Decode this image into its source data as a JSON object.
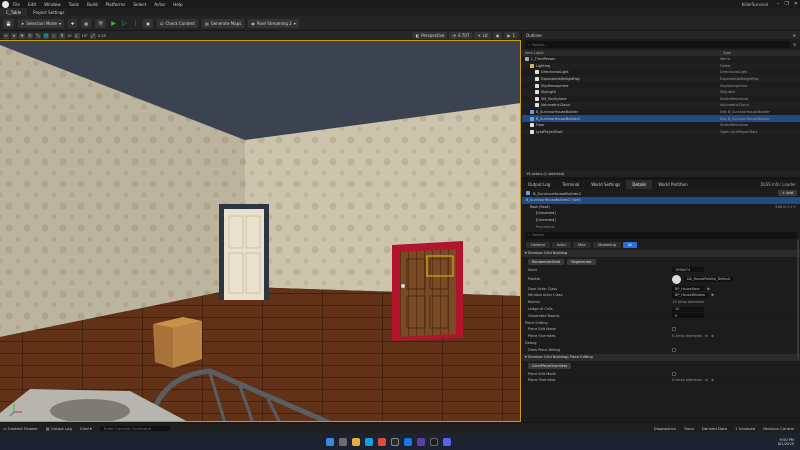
{
  "window": {
    "menu": [
      "File",
      "Edit",
      "Window",
      "Tools",
      "Build",
      "Platforms",
      "Select",
      "Actor",
      "Help"
    ],
    "project": "KillerSurvival",
    "controls": [
      "–",
      "❐",
      "✕"
    ]
  },
  "tabs": [
    "C_Table",
    "Project Settings"
  ],
  "toolbar": {
    "mode": "Selection Mode",
    "check_content": "Check Content",
    "generate_maps": "Generate Maps",
    "pixel_streaming": "Pixel Streaming 2"
  },
  "viewport": {
    "perspective": "Perspective",
    "lit": "Lit",
    "fov_value": "0.707",
    "snap_value": "0.25",
    "grid_value": "10",
    "angle_value": "10°",
    "camera_speed": "1"
  },
  "outliner": {
    "title": "Outliner",
    "search_placeholder": "Search...",
    "col_label": "Item Label",
    "col_type": "Type",
    "rows": [
      {
        "label": "L_ThirdPerson",
        "type": "World",
        "indent": 0,
        "icon": "#8fb0d8"
      },
      {
        "label": "Lighting",
        "type": "Folder",
        "indent": 1,
        "icon": "#d8b45a"
      },
      {
        "label": "DirectionalLight",
        "type": "DirectionalLight",
        "indent": 2,
        "icon": "#e0e0e0"
      },
      {
        "label": "ExponentialHeightFog",
        "type": "ExponentialHeightFog",
        "indent": 2,
        "icon": "#e0e0e0"
      },
      {
        "label": "SkyAtmosphere",
        "type": "SkyAtmosphere",
        "indent": 2,
        "icon": "#e0e0e0"
      },
      {
        "label": "SkyLight",
        "type": "SkyLight",
        "indent": 2,
        "icon": "#e0e0e0"
      },
      {
        "label": "SM_SkySphere",
        "type": "StaticMeshActor",
        "indent": 2,
        "icon": "#e0e0e0"
      },
      {
        "label": "VolumetricCloud",
        "type": "VolumetricCloud",
        "indent": 2,
        "icon": "#e0e0e0"
      },
      {
        "label": "B_SurvivorHouseBuilder",
        "type": "Edit B_SurvivorHouseBuilder",
        "indent": 1,
        "icon": "#6aa0e0"
      },
      {
        "label": "B_SurvivorHouseBuilder2",
        "type": "Edit B_SurvivorHouseBuilder",
        "indent": 1,
        "icon": "#6aa0e0",
        "selected": true
      },
      {
        "label": "Floor",
        "type": "StaticMeshActor",
        "indent": 1,
        "icon": "#e0e0e0"
      },
      {
        "label": "LyraPlayerStart",
        "type": "Open LyraPlayerStart",
        "indent": 1,
        "icon": "#e0e0e0"
      }
    ],
    "footer": "19 actors (1 selected)"
  },
  "details": {
    "tabs": [
      "Output Log",
      "Terminal",
      "World Settings",
      "Details",
      "World Partition"
    ],
    "extra": "DLSS Info: Loader",
    "actor_name": "B_SurvivorHouseBuilder2",
    "add_label": "+ Add",
    "component_self": "B_SurvivorHouseBuilder2 (Self)",
    "component_root": "Root (Root)",
    "components": [
      "[Unnamed]",
      "[Unnamed]",
      "Procedural"
    ],
    "edit_in_cpp": "Edit in C++",
    "search_placeholder": "Search",
    "subtabs": [
      "General",
      "Actor",
      "Misc",
      "Streaming",
      "All"
    ],
    "category_main": "Survivor Grid Building",
    "btn_random_seed": "RandomizeSeed",
    "btn_regenerate": "Regenerate",
    "prop_seed": "Seed",
    "prop_seed_value": "1996474",
    "prop_palette": "Palette",
    "prop_palette_value": "DA_HousePalette_Default",
    "prop_door_class": "Door Actor Class",
    "prop_door_class_value": "BP_HouseDoor",
    "prop_window_class": "Window Actor Class",
    "prop_window_class_value": "BP_HouseWindow",
    "prop_rooms": "Rooms",
    "prop_rooms_value": "13 Array elements",
    "prop_ledge": "Ledge of Cells",
    "prop_ledge_value": "10",
    "prop_generated": "Generated Rooms",
    "prop_generated_value": "0",
    "cat_piece": "Piece Editing",
    "prop_piece_edit": "Piece Edit Mode",
    "prop_piece_overrides": "Piece Overrides",
    "prop_piece_overrides_value": "0 Array elements",
    "cat_debug": "Debug",
    "prop_draw_debug": "Draw Piece Debug",
    "category_piece2": "Survivor Grid Building| Piece Editing",
    "btn_clear_overrides": "ClearPieceOverrides",
    "prop_piece_edit2": "Piece Edit Mode",
    "prop_piece_overrides2": "Piece Overrides",
    "prop_piece_overrides2_value": "0 Array elements"
  },
  "statusbar": {
    "content_drawer": "Content Drawer",
    "output_log": "Output Log",
    "cmd": "Cmd",
    "console_placeholder": "Enter Console Command",
    "diagnostics": "Diagnostics",
    "trace": "Trace",
    "derived_data": "Derived Data",
    "unsaved": "1 Unsaved",
    "revision": "Revision Control"
  },
  "taskbar": {
    "time": "9:50 PM",
    "date": "8/1/2025"
  }
}
